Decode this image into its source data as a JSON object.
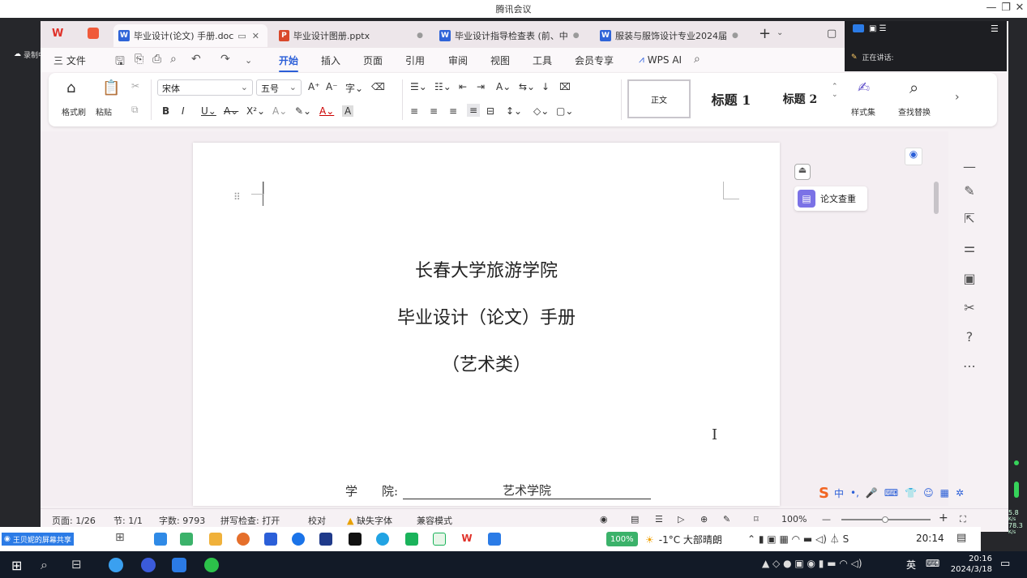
{
  "meeting": {
    "title": "腾讯会议",
    "record_label": "录制中",
    "share_label": "王贝妮的屏幕共享",
    "talking_label": "正在讲话:"
  },
  "tabs": [
    {
      "label": "毕业设计(论文) 手册.doc",
      "type": "doc",
      "active": true
    },
    {
      "label": "毕业设计图册.pptx",
      "type": "ppt",
      "active": false
    },
    {
      "label": "毕业设计指导检查表 (前、中",
      "type": "doc",
      "active": false
    },
    {
      "label": "服装与服饰设计专业2024届 ",
      "type": "doc",
      "active": false
    }
  ],
  "menu": {
    "file": "三 文件",
    "items": [
      "开始",
      "插入",
      "页面",
      "引用",
      "审阅",
      "视图",
      "工具",
      "会员专享"
    ],
    "ai": "WPS AI"
  },
  "ribbon": {
    "format_painter": "格式刷",
    "paste": "粘贴",
    "font_name": "宋体",
    "font_size": "五号",
    "styles": {
      "normal": "正文",
      "h1": "标题 1",
      "h2": "标题 2"
    },
    "style_set": "样式集",
    "find_replace": "查找替换"
  },
  "side_panel": {
    "thesis_check": "论文查重"
  },
  "document": {
    "line1": "长春大学旅游学院",
    "line2": "毕业设计（论文）手册",
    "line3": "（艺术类）",
    "field_label": "学　　院:",
    "field_value": "艺术学院"
  },
  "statusbar": {
    "page": "页面: 1/26",
    "section": "节: 1/1",
    "words": "字数: 9793",
    "spell": "拼写检查: 打开",
    "proof": "校对",
    "missing_font": "缺失字体",
    "compat": "兼容模式",
    "zoom": "100%"
  },
  "inner_taskbar": {
    "battery": "100%",
    "weather": "-1°C 大部晴朗",
    "time": "20:14"
  },
  "host_taskbar": {
    "lang": "英",
    "time": "20:16",
    "date": "2024/3/18"
  },
  "net": {
    "up": "5.8",
    "down": "78.3",
    "unit": "K/s"
  }
}
